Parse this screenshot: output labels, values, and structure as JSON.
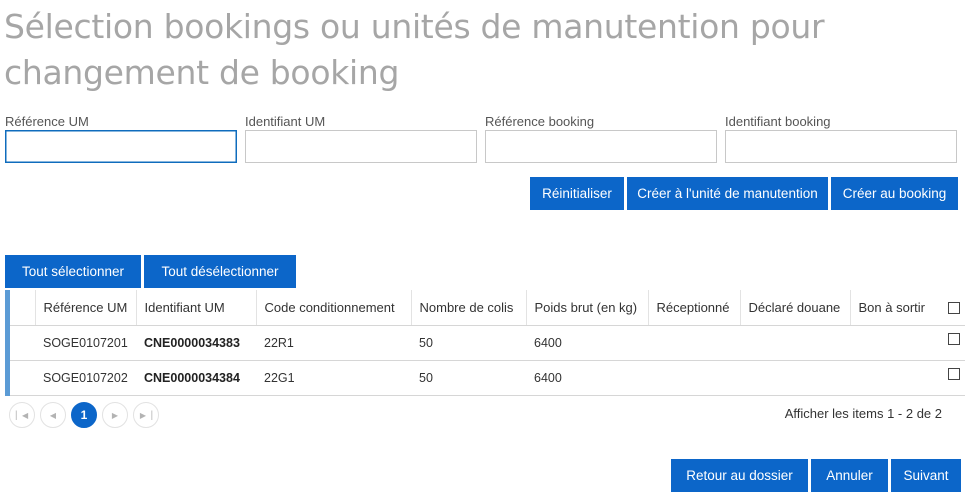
{
  "page": {
    "title": "Sélection bookings ou unités de manutention pour changement de booking"
  },
  "filters": [
    {
      "label": "Référence UM",
      "value": ""
    },
    {
      "label": "Identifiant UM",
      "value": ""
    },
    {
      "label": "Référence booking",
      "value": ""
    },
    {
      "label": "Identifiant booking",
      "value": ""
    }
  ],
  "actions": {
    "reset": "Réinitialiser",
    "create_um": "Créer à l'unité de manutention",
    "create_booking": "Créer au booking"
  },
  "selection": {
    "select_all": "Tout sélectionner",
    "deselect_all": "Tout désélectionner"
  },
  "grid": {
    "columns": [
      "Référence UM",
      "Identifiant UM",
      "Code conditionnement",
      "Nombre de colis",
      "Poids brut (en kg)",
      "Réceptionné",
      "Déclaré douane",
      "Bon à sortir"
    ],
    "rows": [
      {
        "ref_um": "SOGE0107201",
        "id_um": "CNE0000034383",
        "code": "22R1",
        "colis": "50",
        "poids": "6400",
        "receptionne": "",
        "declare": "",
        "bon": "",
        "checked": false
      },
      {
        "ref_um": "SOGE0107202",
        "id_um": "CNE0000034384",
        "code": "22G1",
        "colis": "50",
        "poids": "6400",
        "receptionne": "",
        "declare": "",
        "bon": "",
        "checked": false
      }
    ],
    "accent_color": "#5b9bd5"
  },
  "pager": {
    "first_icon": "first-page-icon",
    "prev_icon": "prev-page-icon",
    "current_page": "1",
    "next_icon": "next-page-icon",
    "last_icon": "last-page-icon",
    "info": "Afficher les items 1 - 2 de 2"
  },
  "footer": {
    "back": "Retour au dossier",
    "cancel": "Annuler",
    "next": "Suivant"
  },
  "colors": {
    "primary": "#0c66c9",
    "title": "#a6a6a6",
    "focus": "#0f6cbd"
  }
}
